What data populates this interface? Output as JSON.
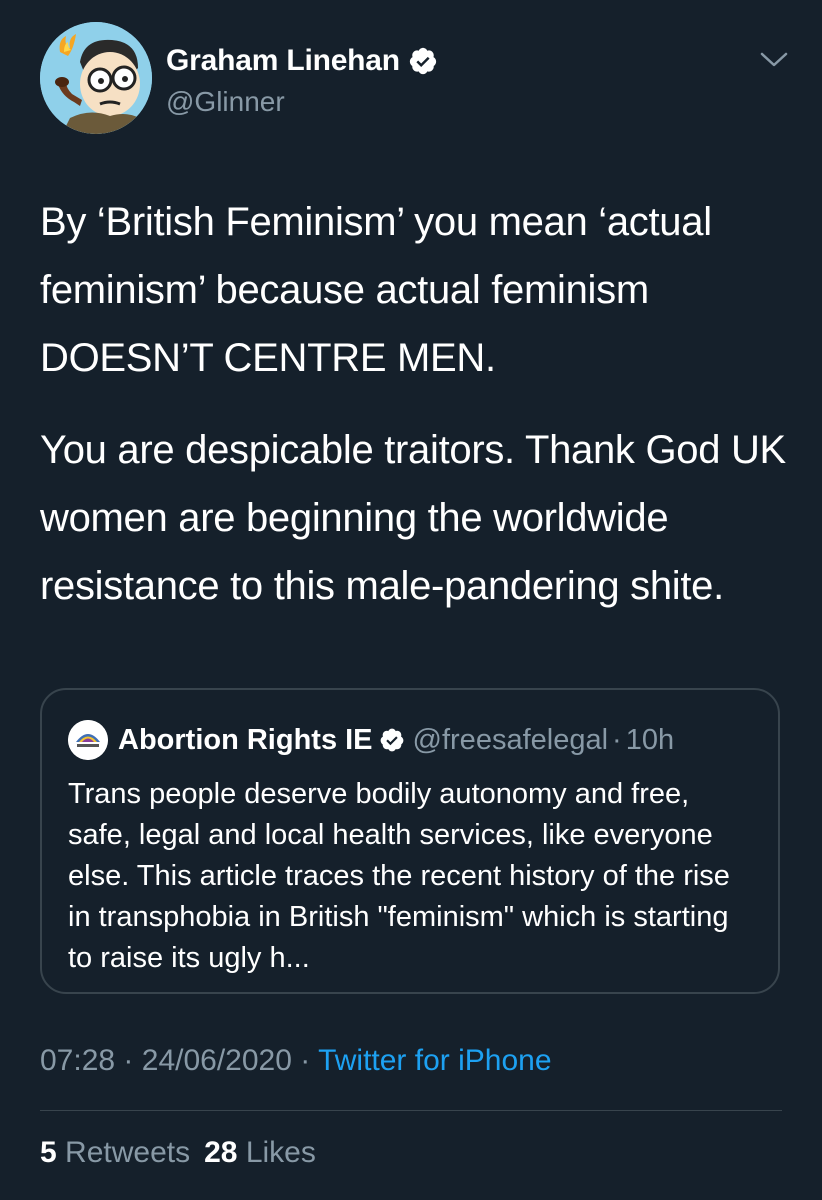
{
  "author": {
    "display_name": "Graham Linehan",
    "handle": "@Glinner",
    "verified": true,
    "avatar_icon": "cartoon-avatar-icon"
  },
  "tweet": {
    "paragraphs": [
      "By ‘British Feminism’ you mean ‘actual feminism’ because actual feminism DOESN’T CENTRE MEN.",
      "You are despicable traitors. Thank God UK women are beginning the worldwide resistance to this male-pandering shite."
    ]
  },
  "quoted_tweet": {
    "display_name": "Abortion Rights IE",
    "handle": "@freesafelegal",
    "separator": "·",
    "time": "10h",
    "verified": true,
    "text": "Trans people deserve bodily autonomy and free, safe, legal and local health services, like everyone else. This article traces the recent history of the rise in transphobia in British \"feminism\" which is starting to raise its ugly h..."
  },
  "meta": {
    "time": "07:28",
    "separator": "·",
    "date": "24/06/2020",
    "source": "Twitter for iPhone"
  },
  "stats": {
    "retweets_count": "5",
    "retweets_label": "Retweets",
    "likes_count": "28",
    "likes_label": "Likes"
  },
  "colors": {
    "background": "#15202b",
    "text_primary": "#ffffff",
    "text_secondary": "#8899a6",
    "accent": "#1da1f2",
    "border": "#38444d"
  }
}
